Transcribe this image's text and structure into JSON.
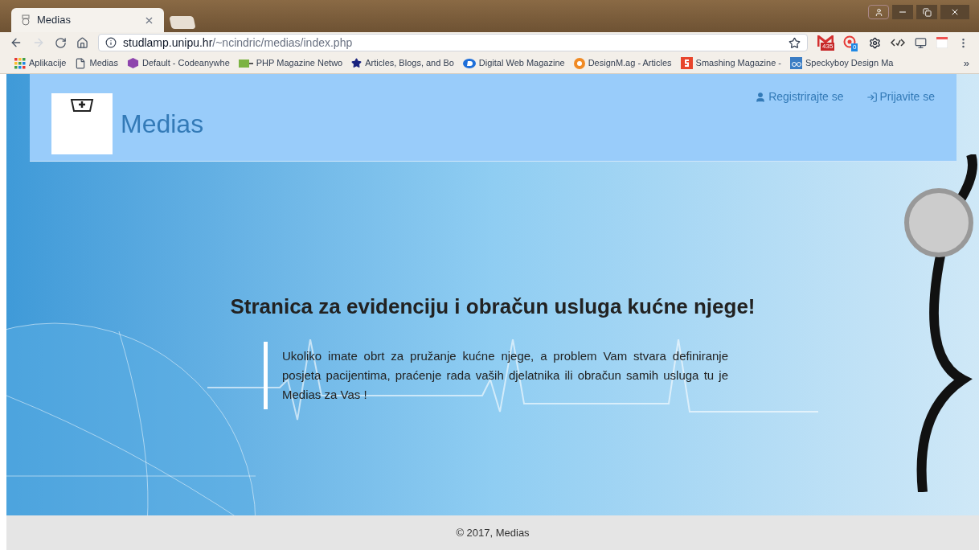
{
  "browser": {
    "tab": {
      "title": "Medias"
    },
    "address": {
      "host": "studlamp.unipu.hr",
      "path": "/~ncindric/medias/index.php"
    },
    "extension_badges": [
      "435",
      "0"
    ],
    "bookmarks": [
      {
        "label": "Aplikacije"
      },
      {
        "label": "Medias"
      },
      {
        "label": "Default - Codeanywhe"
      },
      {
        "label": "PHP Magazine Netwo"
      },
      {
        "label": "Articles, Blogs, and Bo"
      },
      {
        "label": "Digital Web Magazine"
      },
      {
        "label": "DesignM.ag - Articles"
      },
      {
        "label": "Smashing Magazine -"
      },
      {
        "label": "Speckyboy Design Ma"
      }
    ],
    "more": "»"
  },
  "header": {
    "site_name": "Medias",
    "links": [
      {
        "label": "Registrirajte se"
      },
      {
        "label": "Prijavite se"
      }
    ]
  },
  "hero": {
    "heading": "Stranica za evidenciju i obračun usluga kućne njege!",
    "quote": "Ukoliko imate obrt za pružanje kućne njege, a problem Vam stvara definiranje posjeta pacijentima, praćenje rada vaših djelatnika ili obračun samih usluga tu je Medias za Vas !"
  },
  "footer": {
    "text": "© 2017, Medias"
  }
}
